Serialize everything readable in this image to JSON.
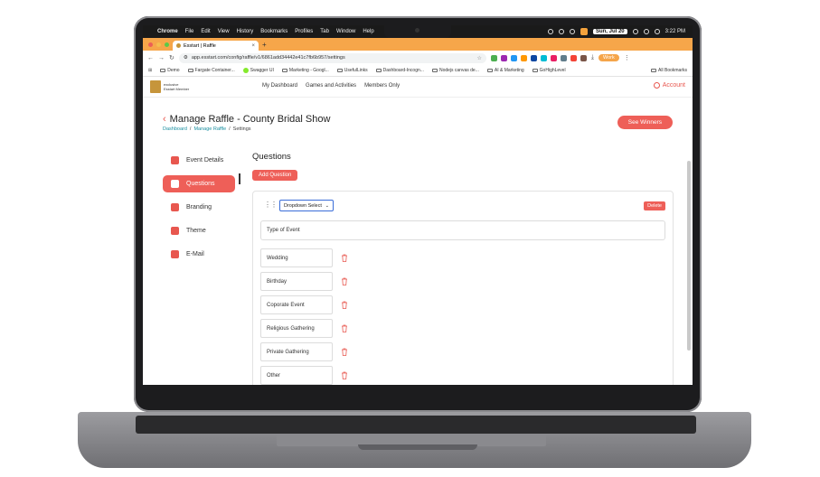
{
  "menubar": {
    "app": "Chrome",
    "items": [
      "File",
      "Edit",
      "View",
      "History",
      "Bookmarks",
      "Profiles",
      "Tab",
      "Window",
      "Help"
    ],
    "date": "Sun, Jul 20",
    "time": "3:22 PM"
  },
  "browser": {
    "tab_title": "Esstart | Raffle",
    "url": "app.esstart.com/config/raffle/v1/6861add34442e41c7fb6b957/settings",
    "profile": "Work",
    "bookmarks": [
      "Demo",
      "Fargate Container...",
      "Swagger UI",
      "Marketing - Googl...",
      "UsefulLinks",
      "Dashboard-Incogn...",
      "Nodejs canvas de...",
      "AI & Marketing",
      "GoHighLevel"
    ],
    "all_bookmarks": "All Bookmarks"
  },
  "header": {
    "logo_line1": "exclusive",
    "logo_line2": "Esstart Member",
    "nav": [
      "My Dashboard",
      "Games and Activities",
      "Members Only"
    ],
    "account": "Account"
  },
  "page": {
    "title": "Manage Raffle - County Bridal Show",
    "breadcrumb": [
      "Dashboard",
      "Manage Raffle",
      "Settings"
    ],
    "see_winners": "See Winners"
  },
  "sidebar": {
    "items": [
      {
        "label": "Event Details",
        "icon": "calendar-icon"
      },
      {
        "label": "Questions",
        "icon": "question-icon",
        "active": true
      },
      {
        "label": "Branding",
        "icon": "branding-icon"
      },
      {
        "label": "Theme",
        "icon": "theme-icon"
      },
      {
        "label": "E-Mail",
        "icon": "mail-icon"
      }
    ]
  },
  "questions": {
    "heading": "Questions",
    "add_label": "Add Question",
    "type_select": "Dropdown Select",
    "delete_label": "Delete",
    "question_text": "Type of Event",
    "options": [
      "Wedding",
      "Birthday",
      "Coporate Event",
      "Religious Gathering",
      "Private Gathering",
      "Other"
    ]
  },
  "colors": {
    "accent": "#ee5f58",
    "chrome_orange": "#f6a64a"
  }
}
